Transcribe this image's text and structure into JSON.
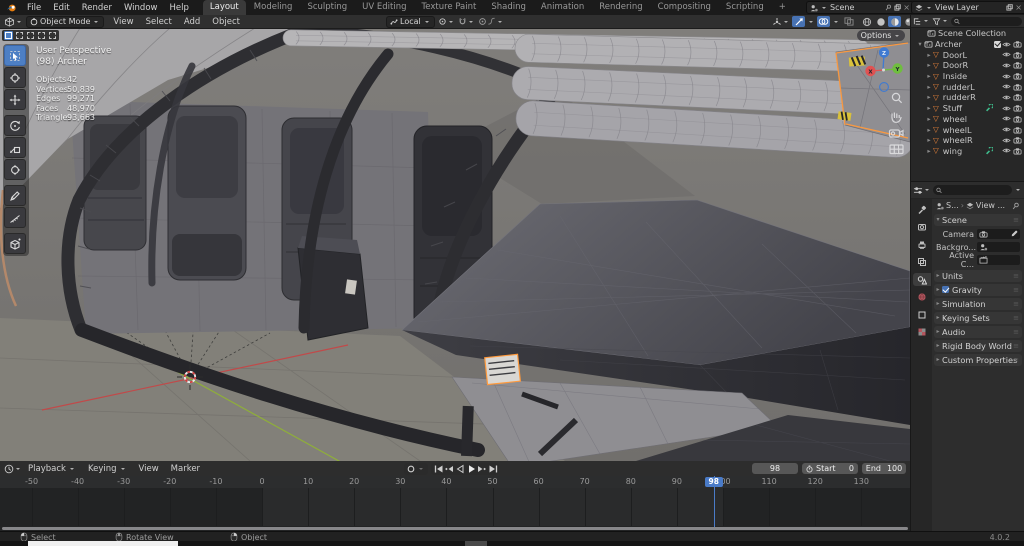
{
  "topbar": {
    "menus": [
      "File",
      "Edit",
      "Render",
      "Window",
      "Help"
    ],
    "workspaces": [
      "Layout",
      "Modeling",
      "Sculpting",
      "UV Editing",
      "Texture Paint",
      "Shading",
      "Animation",
      "Rendering",
      "Compositing",
      "Scripting"
    ],
    "active_workspace": "Layout",
    "add_workspace_label": "+",
    "scene": {
      "label": "Scene"
    },
    "view_layer": {
      "label": "View Layer"
    }
  },
  "viewport_header": {
    "mode_selector": "Object Mode",
    "menus": [
      "View",
      "Select",
      "Add",
      "Object"
    ],
    "transform_orientation": "Local"
  },
  "viewport": {
    "options_button": "Options",
    "view_label": "User Perspective",
    "active_object_label": "(98) Archer",
    "stats": [
      {
        "label": "Objects",
        "value": "42"
      },
      {
        "label": "Vertices",
        "value": "50,839"
      },
      {
        "label": "Edges",
        "value": "99,271"
      },
      {
        "label": "Faces",
        "value": "48,970"
      },
      {
        "label": "Triangles",
        "value": "93,663"
      }
    ],
    "gizmo_axes": {
      "x": "X",
      "y": "Y",
      "z": "Z"
    }
  },
  "outliner": {
    "root_label": "Scene Collection",
    "collection": {
      "name": "Archer",
      "checked": true
    },
    "items": [
      {
        "name": "DoorL",
        "modifier": false
      },
      {
        "name": "DoorR",
        "modifier": false
      },
      {
        "name": "Inside",
        "modifier": false
      },
      {
        "name": "rudderL",
        "modifier": false
      },
      {
        "name": "rudderR",
        "modifier": false
      },
      {
        "name": "Stuff",
        "modifier": true
      },
      {
        "name": "wheel",
        "modifier": false
      },
      {
        "name": "wheelL",
        "modifier": false
      },
      {
        "name": "wheelR",
        "modifier": false
      },
      {
        "name": "wing",
        "modifier": true
      }
    ]
  },
  "properties": {
    "breadcrumb": {
      "scene_label": "S...",
      "view_layer_label": "View ..."
    },
    "scene_panel": {
      "title": "Scene",
      "fields": [
        {
          "label": "Camera",
          "icon": "camera-icon",
          "eyedropper": true
        },
        {
          "label": "Backgro...",
          "icon": "scene-icon",
          "eyedropper": false
        },
        {
          "label": "Active C...",
          "icon": "clip-icon",
          "eyedropper": false
        }
      ]
    },
    "panels": [
      {
        "label": "Units",
        "checkbox": false
      },
      {
        "label": "Gravity",
        "checkbox": true,
        "checked": true
      },
      {
        "label": "Simulation",
        "checkbox": false
      },
      {
        "label": "Keying Sets",
        "checkbox": false
      },
      {
        "label": "Audio",
        "checkbox": false
      },
      {
        "label": "Rigid Body World",
        "checkbox": false
      },
      {
        "label": "Custom Properties",
        "checkbox": false
      }
    ]
  },
  "timeline": {
    "menus": [
      "Playback",
      "Keying",
      "View",
      "Marker"
    ],
    "current_frame": 98,
    "start": {
      "label": "Start",
      "value": "0"
    },
    "end": {
      "label": "End",
      "value": "100"
    },
    "ticks": [
      -50,
      -40,
      -30,
      -20,
      -10,
      0,
      10,
      20,
      30,
      40,
      50,
      60,
      70,
      80,
      90,
      100,
      110,
      120,
      130
    ],
    "frame_range_start": 0,
    "frame_range_end": 100
  },
  "statusbar": {
    "hints": [
      {
        "button": "left",
        "label": "Select"
      },
      {
        "button": "middle",
        "label": "Rotate View"
      },
      {
        "button": "right",
        "label": "Object"
      }
    ],
    "version": "4.0.2"
  },
  "colors": {
    "accent_blue": "#4772b3",
    "selection_orange": "#ff9a3d",
    "axis_x": "#e05252",
    "axis_y": "#6fbe3e",
    "axis_z": "#3f7ad1"
  }
}
